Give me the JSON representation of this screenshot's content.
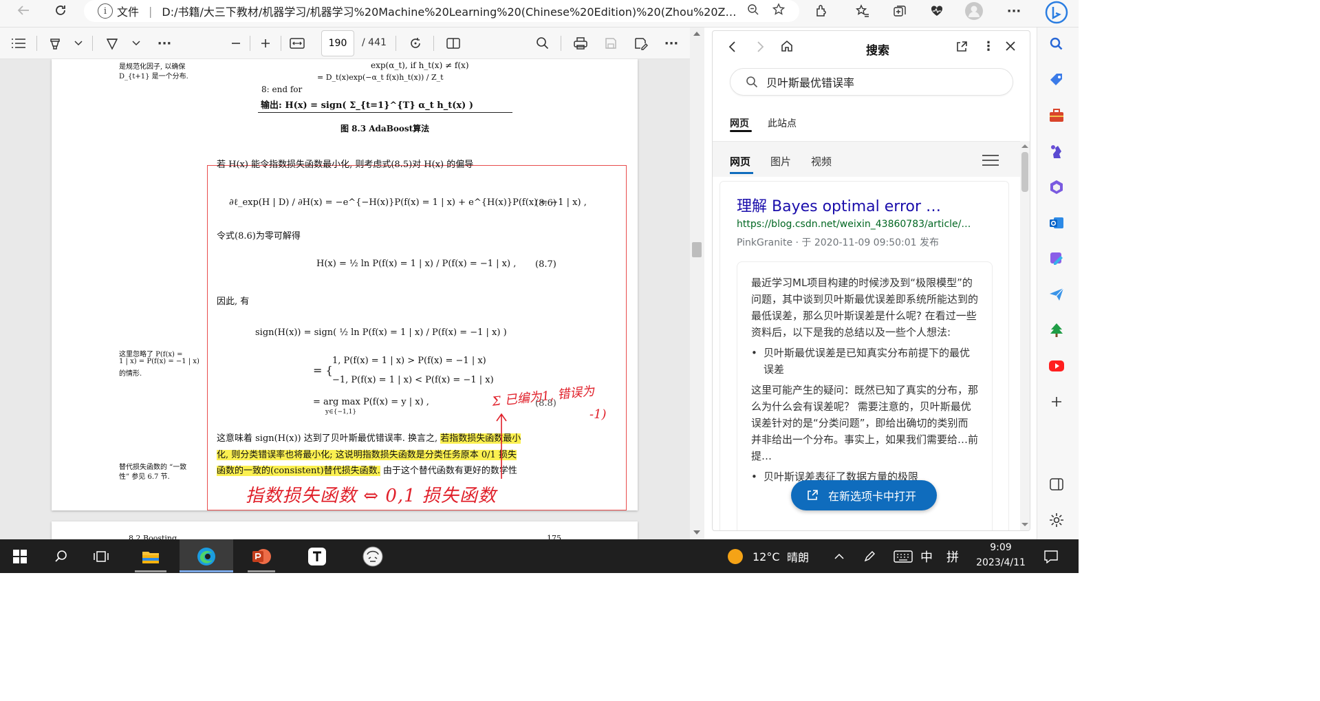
{
  "browser": {
    "file_label": "文件",
    "url": "D:/书籍/大三下教材/机器学习/机器学习%20Machine%20Learning%20(Chinese%20Edition)%20(Zhou%20Zh..."
  },
  "pdf_toolbar": {
    "current_page": "190",
    "total_pages": "/ 441"
  },
  "pdf_page": {
    "margin_note_1": [
      "是规范化因子, 以确保",
      "D_{t+1} 是一个分布."
    ],
    "algo_line_7b": "exp(α_t),    if h_t(x) ≠ f(x)",
    "algo_line_7c": "= D_t(x)exp(−α_t f(x)h_t(x)) / Z_t",
    "algo_line_8": "8:  end for",
    "algo_output": "输出: H(x) = sign( Σ_{t=1}^{T} α_t h_t(x) )",
    "figure_caption": "图 8.3   AdaBoost算法",
    "para_1": "若 H(x) 能令指数损失函数最小化, 则考虑式(8.5)对 H(x) 的偏导",
    "eq_86": "∂ℓ_exp(H | D) / ∂H(x) = −e^{−H(x)}P(f(x) = 1 | x) + e^{H(x)}P(f(x) = −1 | x) ,",
    "eq_86_num": "(8.6)",
    "para_2": "令式(8.6)为零可解得",
    "eq_87": "H(x) = ½ ln  P(f(x) = 1 | x) / P(f(x) = −1 | x) ,",
    "eq_87_num": "(8.7)",
    "para_3": "因此, 有",
    "eq_88_a": "sign(H(x)) = sign( ½ ln  P(f(x) = 1 | x) / P(f(x) = −1 | x) )",
    "eq_88_b": "1,    P(f(x) = 1 | x) > P(f(x) = −1 | x)",
    "eq_88_c": "−1,   P(f(x) = 1 | x) < P(f(x) = −1 | x)",
    "eq_88_d": "= arg max P(f(x) = y | x) ,",
    "eq_88_sub": "y∈{−1,1}",
    "eq_88_num": "(8.8)",
    "margin_note_2": [
      "这里忽略了 P(f(x) =",
      "1 | x) = P(f(x) = −1 | x)",
      "的情形."
    ],
    "para_4_a": "这意味着 sign(H(x)) 达到了贝叶斯最优错误率. 换言之, ",
    "para_4_hl_a": "若指数损失函数最小",
    "para_4_hl_b": "化, 则分类错误率也将最小化; 这说明指数损失函数是分类任务原本 0/1 损失",
    "para_4_hl_c": "函数的一致的(consistent)替代损失函数.",
    "para_4_tail": " 由于这个替代函数有更好的数学性",
    "margin_note_3": [
      "替代损失函数的 “一致",
      "性” 参见 6.7 节."
    ],
    "handwritten_1": "Σ 已编为1, 错误为",
    "handwritten_2": "-1)",
    "handwritten_3": "指数损失函数 ⇔ 0,1 损失函数",
    "next_page_header": "8.2   Boosting",
    "next_page_num": "175"
  },
  "panel": {
    "title": "搜索",
    "query": "贝叶斯最优错误率",
    "scope_web": "网页",
    "scope_site": "此站点",
    "tabs": [
      "网页",
      "图片",
      "视频"
    ],
    "result": {
      "title": "理解 Bayes optimal error …",
      "url": "https://blog.csdn.net/weixin_43860783/article/…",
      "author": "PinkGranite",
      "meta": " · 于 2020-11-09 09:50:01 发布",
      "p1": "最近学习ML项目构建的时候涉及到“极限模型”的问题，其中谈到贝叶斯最优误差即系统所能达到的最低误差，那么贝叶斯误差是什么呢? 在看过一些资料后，以下是我的总结以及一些个人想法:",
      "bullet1": "贝叶斯最优误差是已知真实分布前提下的最优误差",
      "p2": "这里可能产生的疑问：既然已知了真实的分布，那么为什么会有误差呢？ 需要注意的，贝叶斯最优误差针对的是“分类问题”，即给出确切的类别而并非给出一个分布。事实上，如果我们需要给…前提…",
      "bullet2": "贝叶斯误差表征了数据方量的极限"
    },
    "open_new_tab": "在新选项卡中打开"
  },
  "taskbar": {
    "weather_temp": "12°C",
    "weather_desc": "晴朗",
    "ime_1": "中",
    "ime_2": "拼",
    "time": "9:09",
    "date": "2023/4/11"
  }
}
